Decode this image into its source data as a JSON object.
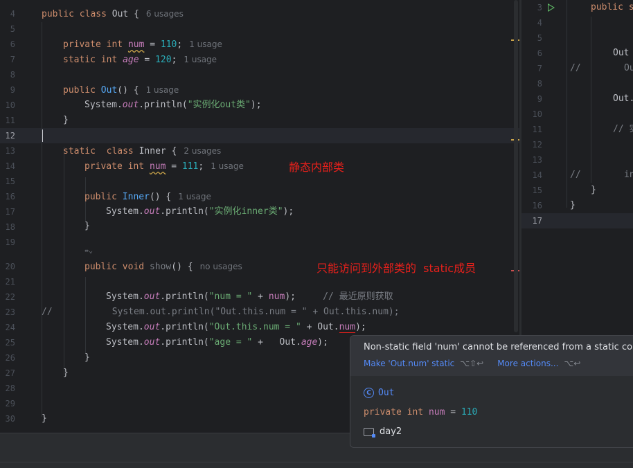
{
  "left_editor": {
    "line_numbers": [
      "4",
      "5",
      "6",
      "7",
      "8",
      "9",
      "10",
      "11",
      "12",
      "13",
      "14",
      "15",
      "16",
      "17",
      "18",
      "19",
      "",
      "20",
      "21",
      "22",
      "23",
      "24",
      "25",
      "26",
      "27",
      "28",
      "29",
      "30"
    ],
    "active_line": "12",
    "line4": {
      "kw1": "public",
      "kw2": "class",
      "name": "Out",
      "brace": " {",
      "hint": "6 usages"
    },
    "line6": {
      "kw1": "private",
      "kw2": "int",
      "field": "num",
      "op": " = ",
      "value": "110",
      "end": ";",
      "hint": "1 usage"
    },
    "line7": {
      "kw1": "static",
      "kw2": "int",
      "field": "age",
      "op": " = ",
      "value": "120",
      "end": ";",
      "hint": "1 usage"
    },
    "line9": {
      "kw1": "public",
      "name": "Out",
      "rest": "() {",
      "hint": "1 usage"
    },
    "line10": {
      "prefix": "System.",
      "field": "out",
      "call": ".println(",
      "str": "\"实例化out类\"",
      "end": ");"
    },
    "line11": {
      "text": "}"
    },
    "line13": {
      "kw1": "static",
      "kw2": "class",
      "name": "Inner",
      "brace": " {",
      "hint": "2 usages"
    },
    "line14": {
      "kw1": "private",
      "kw2": "int",
      "field": "num",
      "op": " = ",
      "value": "111",
      "end": ";",
      "hint": "1 usage"
    },
    "line16": {
      "kw1": "public",
      "name": "Inner",
      "rest": "() {",
      "hint": "1 usage"
    },
    "line17": {
      "prefix": "System.",
      "field": "out",
      "call": ".println(",
      "str": "\"实例化inner类\"",
      "end": ");"
    },
    "line18": {
      "text": "}"
    },
    "line19b": {
      "text": "⇎⌄"
    },
    "line20": {
      "kw1": "public",
      "kw2": "void",
      "name": "show",
      "rest": "() {",
      "hint": "no usages"
    },
    "line22": {
      "prefix": "System.",
      "field": "out",
      "call": ".println(",
      "str": "\"num = \"",
      "rest": " + ",
      "field2": "num",
      "end": ");",
      "comment": "// 最近原则获取"
    },
    "line23": {
      "text": "//           System.out.println(\"Out.this.num = \" + Out.this.num);"
    },
    "line24": {
      "prefix": "System.",
      "field": "out",
      "call": ".println(",
      "str": "\"Out.this.num = \"",
      "rest": " + Out.",
      "field2": "num",
      "end": ");"
    },
    "line25": {
      "prefix": "System.",
      "field": "out",
      "call": ".println(",
      "str": "\"age = \"",
      "rest": " +   Out.",
      "field2": "age",
      "end": ");"
    },
    "line26": {
      "text": "}"
    },
    "line27": {
      "text": "}"
    },
    "line30": {
      "text": "}"
    },
    "annotations": {
      "static_inner": "静态内部类",
      "access_note": "只能访问到外部类的  static成员"
    }
  },
  "right_editor": {
    "line_numbers": [
      "3",
      "4",
      "5",
      "6",
      "7",
      "8",
      "9",
      "10",
      "11",
      "12",
      "13",
      "14",
      "15",
      "16",
      "17"
    ],
    "active_line": "17",
    "lines": {
      "l3": "public s",
      "l6": "Out",
      "l7a": "//",
      "l7b": "Ou",
      "l9": "Out.",
      "l11": "// 实",
      "l14a": "//",
      "l14b": "in",
      "l15": "}",
      "l16": "}"
    }
  },
  "popup": {
    "message": "Non-static field 'num' cannot be referenced from a static context",
    "action1": "Make 'Out.num' static",
    "action1_shortcut": "⌥⇧↩",
    "action2": "More actions...",
    "action2_shortcut": "⌥↩",
    "class_icon": "C",
    "class_name": "Out",
    "decl_kw1": "private",
    "decl_kw2": "int",
    "decl_field": "num",
    "decl_op": " = ",
    "decl_value": "110",
    "package": "day2"
  },
  "colors": {
    "background": "#1e1f22",
    "keyword": "#cf8e6d",
    "field": "#c77dbb",
    "number": "#2aacb8",
    "string": "#6aab73",
    "method": "#56a8f5",
    "annotation_red": "#e7201b",
    "link": "#548af7"
  }
}
